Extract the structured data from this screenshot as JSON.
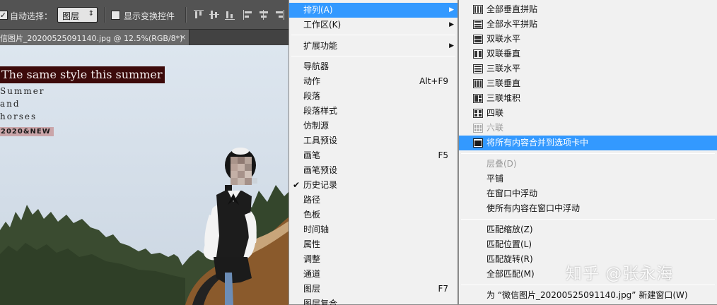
{
  "options_bar": {
    "auto_select_label": "自动选择：",
    "auto_select_checked": true,
    "auto_select_target": "图层",
    "show_transform_label": "显示变换控件",
    "show_transform_checked": false
  },
  "document_tab": {
    "title": "信图片_20200525091140.jpg @ 12.5%(RGB/8*)",
    "close_glyph": "×"
  },
  "canvas_text": {
    "title": "The same style this summer",
    "line1": "Summer",
    "line2": "and",
    "line3": "horses",
    "year_badge": "2020&NEW"
  },
  "window_menu": {
    "items": [
      {
        "label": "排列(A)",
        "highlighted": true,
        "has_submenu": true
      },
      {
        "label": "工作区(K)",
        "has_submenu": true
      },
      {
        "label": "扩展功能",
        "has_submenu": true
      },
      {
        "label": "导航器"
      },
      {
        "label": "动作",
        "shortcut": "Alt+F9"
      },
      {
        "label": "段落"
      },
      {
        "label": "段落样式"
      },
      {
        "label": "仿制源"
      },
      {
        "label": "工具预设"
      },
      {
        "label": "画笔",
        "shortcut": "F5"
      },
      {
        "label": "画笔预设"
      },
      {
        "label": "历史记录",
        "checked": true,
        "check_glyph": "✔"
      },
      {
        "label": "路径"
      },
      {
        "label": "色板"
      },
      {
        "label": "时间轴"
      },
      {
        "label": "属性"
      },
      {
        "label": "调整"
      },
      {
        "label": "通道"
      },
      {
        "label": "图层",
        "shortcut": "F7"
      },
      {
        "label": "图层复合"
      }
    ]
  },
  "arrange_submenu": {
    "items": [
      {
        "label": "全部垂直拼贴",
        "icon": "tile-vertical-icon"
      },
      {
        "label": "全部水平拼贴",
        "icon": "tile-horizontal-icon"
      },
      {
        "label": "双联水平",
        "icon": "two-up-horizontal-icon"
      },
      {
        "label": "双联垂直",
        "icon": "two-up-vertical-icon"
      },
      {
        "label": "三联水平",
        "icon": "three-up-horizontal-icon"
      },
      {
        "label": "三联垂直",
        "icon": "three-up-vertical-icon"
      },
      {
        "label": "三联堆积",
        "icon": "three-up-stacked-icon"
      },
      {
        "label": "四联",
        "icon": "four-up-icon"
      },
      {
        "label": "六联",
        "icon": "six-up-icon",
        "disabled": true
      },
      {
        "label": "将所有内容合并到选项卡中",
        "icon": "consolidate-tabs-icon",
        "highlighted": true
      },
      {
        "label": "层叠(D)",
        "disabled": true
      },
      {
        "label": "平铺"
      },
      {
        "label": "在窗口中浮动"
      },
      {
        "label": "使所有内容在窗口中浮动"
      },
      {
        "label": "匹配缩放(Z)"
      },
      {
        "label": "匹配位置(L)"
      },
      {
        "label": "匹配旋转(R)"
      },
      {
        "label": "全部匹配(M)"
      },
      {
        "label": "为 “微信图片_20200525091140.jpg” 新建窗口(W)"
      }
    ]
  },
  "watermark": "知乎 @张永海",
  "colors": {
    "menu_highlight": "#3399ff",
    "menu_background": "#f1f1f1",
    "app_chrome": "#535353",
    "title_band": "#3c0a0a"
  }
}
